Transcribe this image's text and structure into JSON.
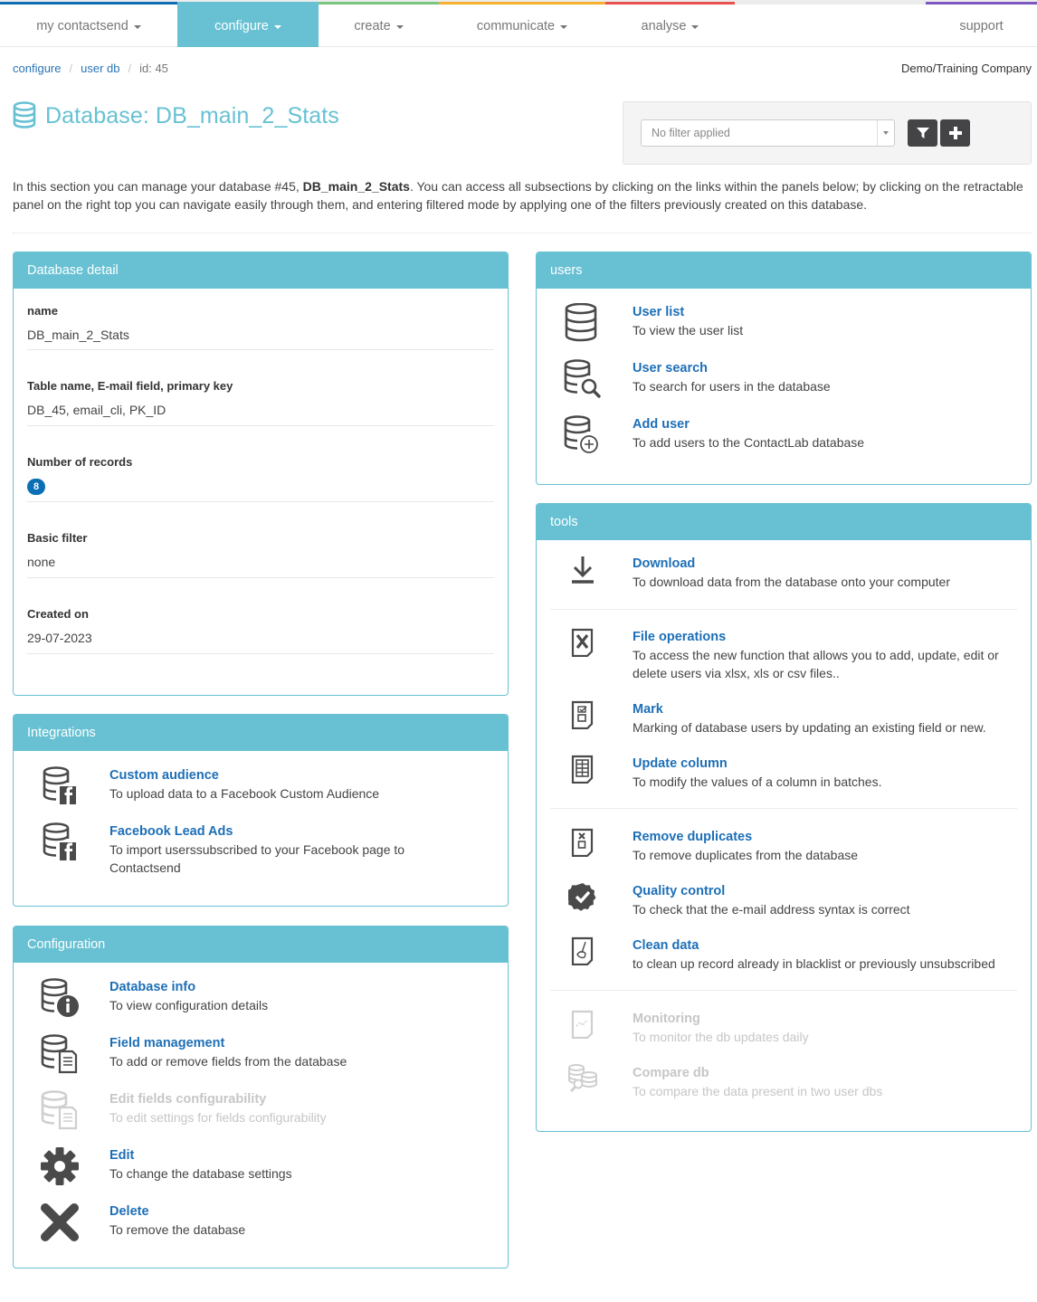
{
  "nav": {
    "items": [
      {
        "label": "my contactsend",
        "color": "#0f6db5",
        "has_caret": true
      },
      {
        "label": "configure",
        "color": "#67c1d3",
        "has_caret": true,
        "active": true
      },
      {
        "label": "create",
        "color": "#7cc57e",
        "has_caret": true
      },
      {
        "label": "communicate",
        "color": "#f6b030",
        "has_caret": true
      },
      {
        "label": "analyse",
        "color": "#e9534f",
        "has_caret": true
      },
      {
        "label": "support",
        "color": "#7e57c2",
        "has_caret": false
      }
    ]
  },
  "breadcrumb": {
    "items": [
      "configure",
      "user db"
    ],
    "current": "id: 45"
  },
  "company": "Demo/Training Company",
  "page": {
    "title": "Database: DB_main_2_Stats"
  },
  "filter": {
    "placeholder": "No filter applied",
    "filter_button": "filter-icon",
    "add_button": "plus-icon"
  },
  "intro": {
    "before": "In this section you can manage your database #45, ",
    "bold": "DB_main_2_Stats",
    "after": ". You can access all subsections by clicking on the links within the panels below; by clicking on the retractable panel on the right top you can navigate easily through them, and entering filtered mode by applying one of the filters previously created on this database."
  },
  "database_detail": {
    "title": "Database detail",
    "fields": [
      {
        "label": "name",
        "value": "DB_main_2_Stats"
      },
      {
        "label": "Table name, E-mail field, primary key",
        "value": "DB_45, email_cli, PK_ID"
      },
      {
        "label": "Number of records",
        "value": "8"
      },
      {
        "label": "Basic filter",
        "value": "none"
      },
      {
        "label": "Created on",
        "value": "29-07-2023"
      }
    ]
  },
  "integrations": {
    "title": "Integrations",
    "items": [
      {
        "title": "Custom audience",
        "desc": "To upload data to a Facebook Custom Audience",
        "icon": "database-facebook-icon"
      },
      {
        "title": "Facebook Lead Ads",
        "desc": "To import userssubscribed to your Facebook page to Contactsend",
        "icon": "database-facebook-icon"
      }
    ]
  },
  "configuration": {
    "title": "Configuration",
    "items": [
      {
        "title": "Database info",
        "desc": "To view configuration details",
        "icon": "database-info-icon",
        "disabled": false
      },
      {
        "title": "Field management",
        "desc": "To add or remove fields from the database",
        "icon": "database-fields-icon",
        "disabled": false
      },
      {
        "title": "Edit fields configurability",
        "desc": "To edit settings for fields configurability",
        "icon": "database-fields-icon",
        "disabled": true
      },
      {
        "title": "Edit",
        "desc": "To change the database settings",
        "icon": "gear-icon",
        "disabled": false
      },
      {
        "title": "Delete",
        "desc": "To remove the database",
        "icon": "close-icon",
        "disabled": false
      }
    ]
  },
  "users": {
    "title": "users",
    "items": [
      {
        "title": "User list",
        "desc": "To view the user list",
        "icon": "database-icon"
      },
      {
        "title": "User search",
        "desc": "To search for users in the database",
        "icon": "database-search-icon"
      },
      {
        "title": "Add user",
        "desc": "To add users to the ContactLab database",
        "icon": "database-add-icon"
      }
    ]
  },
  "tools": {
    "title": "tools",
    "items": [
      {
        "title": "Download",
        "desc": "To download data from the database onto your computer",
        "icon": "download-icon",
        "disabled": false
      },
      {
        "title": "File operations",
        "desc": "To access the new function that allows you to add, update, edit or delete users via xlsx, xls or csv files..",
        "icon": "excel-file-icon",
        "disabled": false
      },
      {
        "title": "Mark",
        "desc": "Marking of database users by updating an existing field or new.",
        "icon": "checklist-file-icon",
        "disabled": false
      },
      {
        "title": "Update column",
        "desc": "To modify the values of a column in batches.",
        "icon": "table-file-icon",
        "disabled": false
      },
      {
        "title": "Remove duplicates",
        "desc": "To remove duplicates from the database",
        "icon": "duplicates-file-icon",
        "disabled": false
      },
      {
        "title": "Quality control",
        "desc": "To check that the e-mail address syntax is correct",
        "icon": "verified-badge-icon",
        "disabled": false
      },
      {
        "title": "Clean data",
        "desc": "to clean up record already in blacklist or previously unsubscribed",
        "icon": "broom-file-icon",
        "disabled": false
      },
      {
        "title": "Monitoring",
        "desc": "To monitor the db updates daily",
        "icon": "chart-file-icon",
        "disabled": true
      },
      {
        "title": "Compare db",
        "desc": "To compare the data present in two user dbs",
        "icon": "compare-db-icon",
        "disabled": true
      }
    ]
  }
}
